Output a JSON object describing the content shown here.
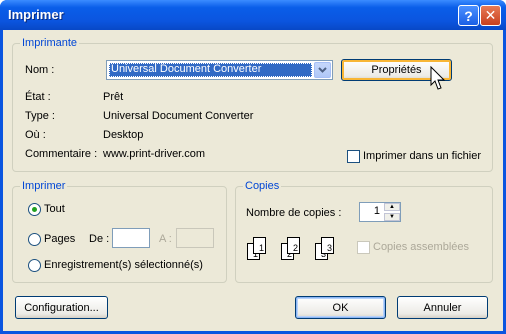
{
  "window": {
    "title": "Imprimer"
  },
  "titlebar": {
    "help_glyph": "?",
    "close_glyph": "✕"
  },
  "printer_group": {
    "label": "Imprimante",
    "name_label": "Nom :",
    "selected_printer": "Universal Document Converter",
    "properties_button": "Propriétés",
    "status_label": "État :",
    "status_value": "Prêt",
    "type_label": "Type :",
    "type_value": "Universal Document Converter",
    "where_label": "Où :",
    "where_value": "Desktop",
    "comment_label": "Commentaire :",
    "comment_value": "www.print-driver.com",
    "print_to_file_label": "Imprimer dans un fichier",
    "print_to_file_checked": false
  },
  "print_range_group": {
    "label": "Imprimer",
    "all_label": "Tout",
    "pages_label": "Pages",
    "from_label": "De :",
    "to_label": "A :",
    "from_value": "",
    "to_value": "",
    "selection_label": "Enregistrement(s) sélectionné(s)",
    "selected_option": "Tout"
  },
  "copies_group": {
    "label": "Copies",
    "count_label": "Nombre de copies :",
    "count_value": "1",
    "collate_label": "Copies assemblées",
    "collate_checked": false,
    "collate_icon_pages": [
      "1",
      "1",
      "2",
      "2",
      "3",
      "3"
    ]
  },
  "footer": {
    "setup_button": "Configuration...",
    "ok_button": "OK",
    "cancel_button": "Annuler"
  },
  "colors": {
    "titlebar": "#0a55e0",
    "dialog_bg": "#ece9d8",
    "group_label": "#0046d5",
    "selection": "#316ac5"
  }
}
